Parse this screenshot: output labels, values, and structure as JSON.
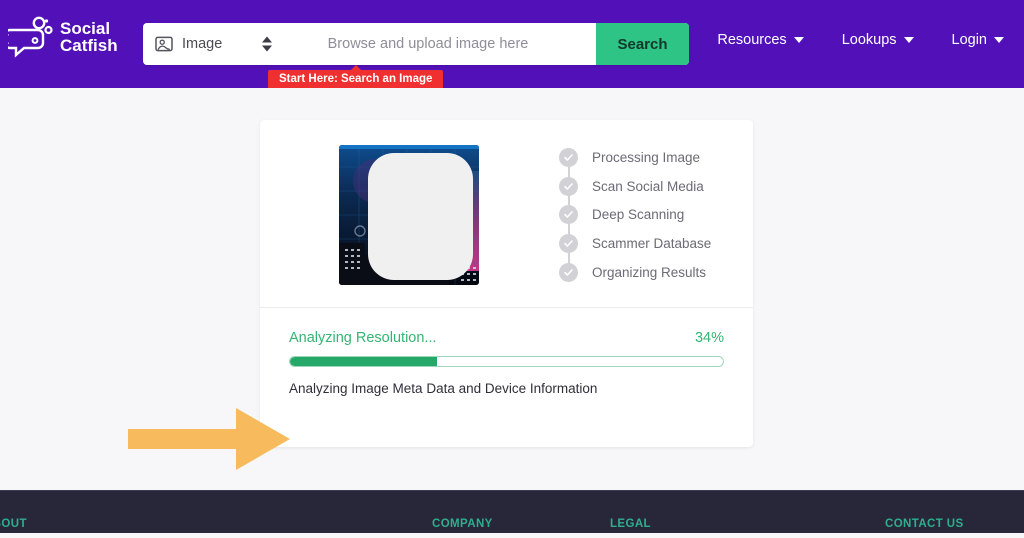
{
  "header": {
    "brand": {
      "name": "Social\nCatfish",
      "icon": "speech-bubble-fish-logo-icon"
    },
    "search": {
      "type_icon": "image-icon",
      "type_value": "Image",
      "stepper_icon": "up-down-arrows-icon",
      "upload_placeholder": "Browse and upload image here",
      "search_button": "Search"
    },
    "tooltip": "Start Here: Search an Image",
    "nav": [
      {
        "label": "Resources",
        "caret": "chevron-down-icon"
      },
      {
        "label": "Lookups",
        "caret": "chevron-down-icon"
      },
      {
        "label": "Login",
        "caret": "chevron-down-icon"
      }
    ]
  },
  "main": {
    "thumbnail_alt": "uploaded-image-preview",
    "steps": [
      {
        "label": "Processing Image",
        "icon": "check-circle-icon"
      },
      {
        "label": "Scan Social Media",
        "icon": "check-circle-icon"
      },
      {
        "label": "Deep Scanning",
        "icon": "check-circle-icon"
      },
      {
        "label": "Scammer Database",
        "icon": "check-circle-icon"
      },
      {
        "label": "Organizing Results",
        "icon": "check-circle-icon"
      }
    ],
    "progress": {
      "title": "Analyzing Resolution...",
      "percent_label": "34%",
      "percent_value": 34,
      "subtitle": "Analyzing Image Meta Data and Device Information"
    },
    "annotation": {
      "icon": "right-arrow-annotation-icon",
      "color": "#f7bb5e"
    }
  },
  "footer": {
    "columns": [
      "ABOUT",
      "COMPANY",
      "LEGAL",
      "CONTACT US"
    ]
  },
  "colors": {
    "header_purple": "#5211b8",
    "search_green": "#2ec485",
    "progress_green": "#25a868",
    "tooltip_red": "#f03030",
    "footer_navy": "#272739",
    "footer_teal": "#2fae8e",
    "arrow_orange": "#f7bb5e"
  }
}
